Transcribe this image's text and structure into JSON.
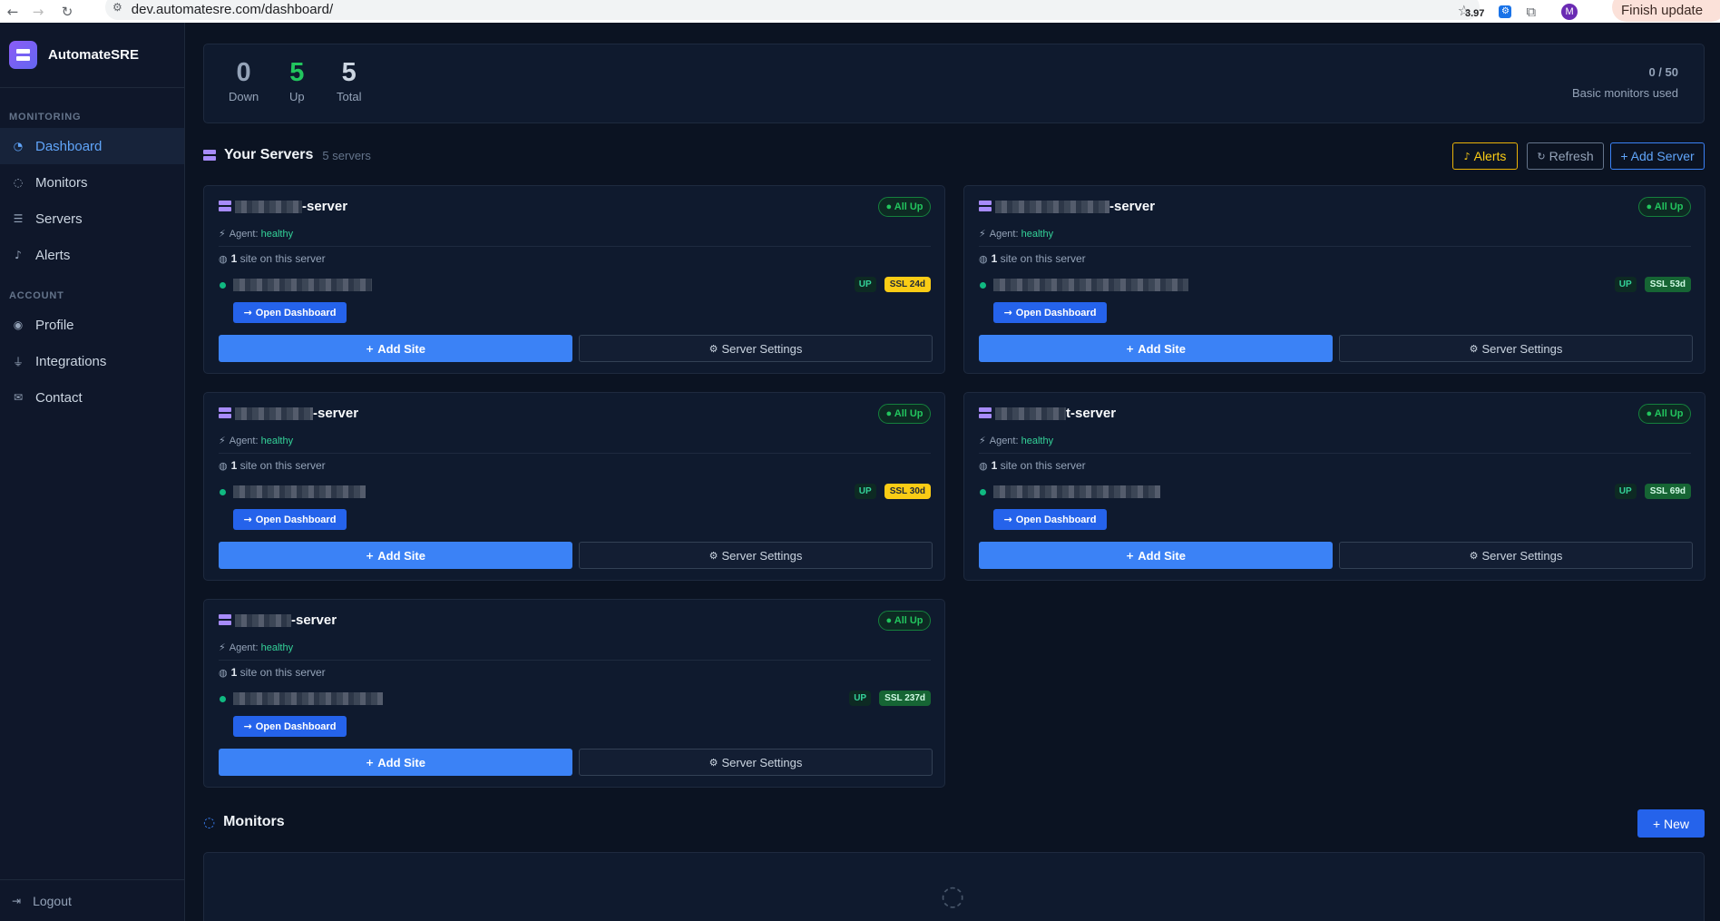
{
  "browser": {
    "url": "dev.automatesre.com/dashboard/",
    "ext_badge": "3.97",
    "avatar_letter": "M",
    "finish_update": "Finish update"
  },
  "sidebar": {
    "brand": "AutomateSRE",
    "monitoring_label": "MONITORING",
    "account_label": "ACCOUNT",
    "items": {
      "dashboard": "Dashboard",
      "monitors": "Monitors",
      "servers": "Servers",
      "alerts": "Alerts",
      "profile": "Profile",
      "integrations": "Integrations",
      "contact": "Contact"
    },
    "logout": "Logout"
  },
  "stats": {
    "down": {
      "value": "0",
      "label": "Down"
    },
    "up": {
      "value": "5",
      "label": "Up"
    },
    "total": {
      "value": "5",
      "label": "Total"
    },
    "quota": "0 / 50",
    "quota_label": "Basic monitors used"
  },
  "servers_section": {
    "title": "Your Servers",
    "count": "5 servers",
    "alerts_btn": "Alerts",
    "refresh_btn": "Refresh",
    "add_server_btn": "+ Add Server"
  },
  "server_cards": [
    {
      "name_suffix": "-server",
      "status": "● All Up",
      "agent_label": "Agent:",
      "agent_status": "healthy",
      "sites_num": "1",
      "sites_text": "site on this server",
      "site_state": "UP",
      "ssl": "SSL 24d",
      "open_dashboard": "Open Dashboard",
      "add_site": "Add Site",
      "server_settings": "Server Settings"
    },
    {
      "name_suffix": "-server",
      "status": "● All Up",
      "agent_label": "Agent:",
      "agent_status": "healthy",
      "sites_num": "1",
      "sites_text": "site on this server",
      "site_state": "UP",
      "ssl": "SSL 53d",
      "open_dashboard": "Open Dashboard",
      "add_site": "Add Site",
      "server_settings": "Server Settings"
    },
    {
      "name_suffix": "-server",
      "status": "● All Up",
      "agent_label": "Agent:",
      "agent_status": "healthy",
      "sites_num": "1",
      "sites_text": "site on this server",
      "site_state": "UP",
      "ssl": "SSL 30d",
      "open_dashboard": "Open Dashboard",
      "add_site": "Add Site",
      "server_settings": "Server Settings"
    },
    {
      "name_suffix": "t-server",
      "status": "● All Up",
      "agent_label": "Agent:",
      "agent_status": "healthy",
      "sites_num": "1",
      "sites_text": "site on this server",
      "site_state": "UP",
      "ssl": "SSL 69d",
      "open_dashboard": "Open Dashboard",
      "add_site": "Add Site",
      "server_settings": "Server Settings"
    },
    {
      "name_suffix": "-server",
      "status": "● All Up",
      "agent_label": "Agent:",
      "agent_status": "healthy",
      "sites_num": "1",
      "sites_text": "site on this server",
      "site_state": "UP",
      "ssl": "SSL 237d",
      "open_dashboard": "Open Dashboard",
      "add_site": "Add Site",
      "server_settings": "Server Settings"
    }
  ],
  "monitors_section": {
    "title": "Monitors",
    "new_btn": "+ New"
  },
  "colors": {
    "up_green": "#22c55e",
    "accent_blue": "#3b82f6",
    "warning_yellow": "#facc15",
    "brand_purple": "#8b5cf6"
  }
}
